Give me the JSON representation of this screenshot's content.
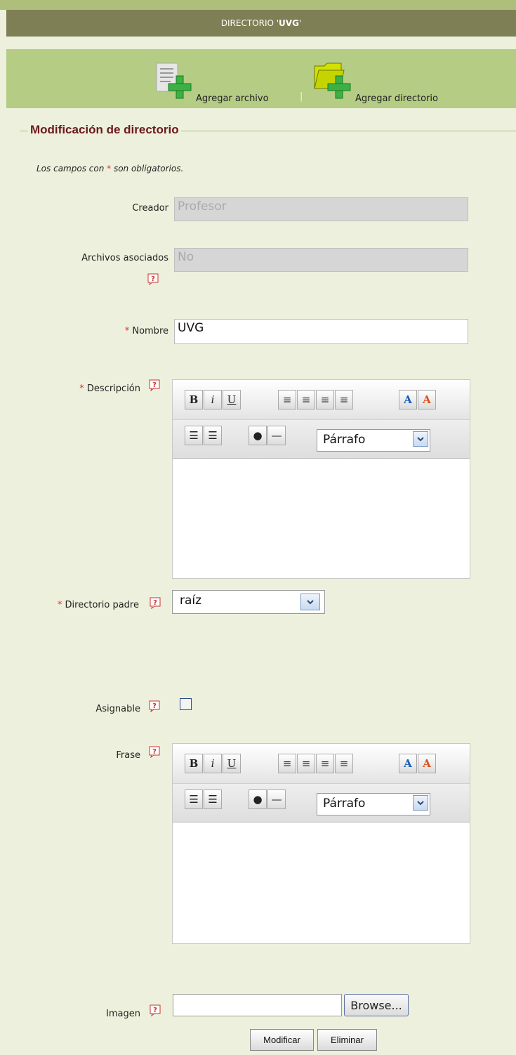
{
  "header": {
    "title_prefix": "DIRECTORIO '",
    "title_name": "UVG",
    "title_suffix": "'"
  },
  "actions": {
    "add_file": "Agregar archivo",
    "separator": "|",
    "add_dir": "Agregar directorio"
  },
  "form": {
    "legend": "Modificación de directorio",
    "note_before": "Los campos con ",
    "note_star": "*",
    "note_after": " son obligatorios.",
    "fields": {
      "creador_label": "Creador",
      "creador_value": "Profesor",
      "archivos_label": "Archivos asociados",
      "archivos_value": "No",
      "nombre_label": "Nombre",
      "nombre_value": "UVG",
      "descripcion_label": "Descripción",
      "directorio_label": "Directorio padre",
      "directorio_value": "raíz",
      "asignable_label": "Asignable",
      "frase_label": "Frase",
      "imagen_label": "Imagen"
    },
    "required_mark": "*",
    "editor_format": "Párrafo",
    "browse_label": "Browse...",
    "modify_label": "Modificar",
    "delete_label": "Eliminar"
  },
  "colors": {
    "accent_green": "#b4cc84",
    "title_bar": "#7f7f55",
    "legend": "#6a1a1a",
    "required": "#dd3333"
  }
}
